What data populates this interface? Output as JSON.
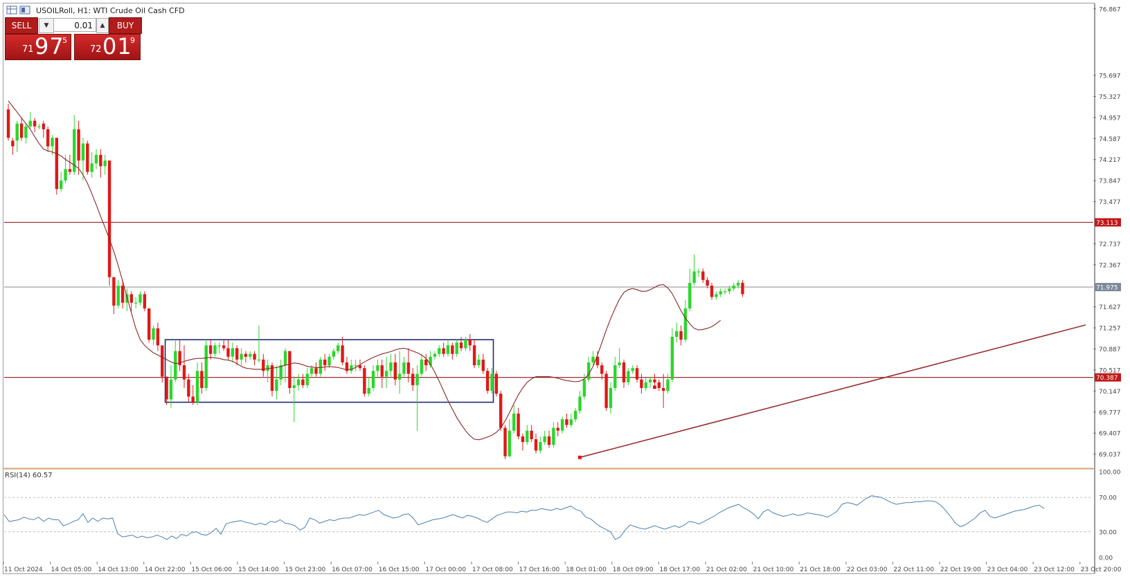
{
  "window": {
    "title": "USOILRoll, H1:  WTI Crude Oil Cash CFD"
  },
  "trade_panel": {
    "sell_label": "SELL",
    "buy_label": "BUY",
    "lot_value": "0.01",
    "sell_price": {
      "prefix": "71",
      "big": "97",
      "sup": "5"
    },
    "buy_price": {
      "prefix": "72",
      "big": "01",
      "sup": "9"
    }
  },
  "indicator": {
    "label": "RSI(14) 60.57"
  },
  "colors": {
    "bull": "#2bd62b",
    "bear": "#e01818",
    "ma_line": "#8b2525",
    "level_line": "#9a3030",
    "rsi_line": "#4a7fb0",
    "box": "#1e2a6e",
    "label_bg": "#c01818"
  },
  "chart_data": {
    "type": "candlestick",
    "symbol": "USOILRoll",
    "timeframe": "H1",
    "price_axis": {
      "ylim": [
        68.85,
        76.95
      ],
      "ticks": [
        "76.867",
        "75.697",
        "75.327",
        "74.957",
        "74.587",
        "74.217",
        "73.847",
        "73.477",
        "72.737",
        "72.367",
        "71.627",
        "71.257",
        "70.887",
        "70.517",
        "70.147",
        "69.777",
        "69.407",
        "69.037"
      ]
    },
    "time_axis": {
      "labels": [
        "11 Oct 2024",
        "14 Oct 05:00",
        "14 Oct 13:00",
        "14 Oct 22:00",
        "15 Oct 06:00",
        "15 Oct 14:00",
        "15 Oct 23:00",
        "16 Oct 07:00",
        "16 Oct 15:00",
        "17 Oct 00:00",
        "17 Oct 08:00",
        "17 Oct 16:00",
        "18 Oct 01:00",
        "18 Oct 09:00",
        "18 Oct 17:00",
        "21 Oct 02:00",
        "21 Oct 10:00",
        "21 Oct 18:00",
        "22 Oct 03:00",
        "22 Oct 11:00",
        "22 Oct 19:00",
        "23 Oct 04:00",
        "23 Oct 12:00",
        "23 Oct 20:00"
      ]
    },
    "horizontal_levels": [
      {
        "value": 73.113,
        "label": "73.113",
        "style": "red"
      },
      {
        "value": 71.975,
        "label": "71.975",
        "style": "grey"
      },
      {
        "value": 70.387,
        "label": "70.387",
        "style": "red"
      }
    ],
    "range_box": {
      "x_start": 36,
      "x_end": 110,
      "top": 71.05,
      "bottom": 69.95
    },
    "trendline": {
      "x1": 130,
      "y1": 68.98,
      "x2": 224,
      "y2": 71.31
    },
    "ma_values": [
      75.25,
      75.15,
      75.05,
      74.95,
      74.85,
      74.75,
      74.62,
      74.5,
      74.4,
      74.37,
      74.35,
      74.32,
      74.28,
      74.22,
      74.17,
      74.12,
      74.06,
      73.95,
      73.8,
      73.62,
      73.42,
      73.22,
      73.02,
      72.82,
      72.6,
      72.35,
      72.08,
      71.8,
      71.52,
      71.25,
      71.05,
      70.95,
      70.88,
      70.82,
      70.78,
      70.74,
      70.7,
      70.66,
      70.63,
      70.64,
      70.67,
      70.69,
      70.71,
      70.72,
      70.72,
      70.73,
      70.74,
      70.73,
      70.72,
      70.7,
      70.69,
      70.67,
      70.63,
      70.58,
      70.55,
      70.54,
      70.53,
      70.53,
      70.53,
      70.54,
      70.55,
      70.56,
      70.58,
      70.6,
      70.62,
      70.64,
      70.63,
      70.61,
      70.58,
      70.57,
      70.56,
      70.56,
      70.57,
      70.58,
      70.57,
      70.56,
      70.54,
      70.52,
      70.53,
      70.56,
      70.61,
      70.66,
      70.7,
      70.74,
      70.77,
      70.8,
      70.82,
      70.84,
      70.87,
      70.89,
      70.9,
      70.88,
      70.85,
      70.82,
      70.78,
      70.72,
      70.62,
      70.48,
      70.32,
      70.15,
      69.98,
      69.83,
      69.68,
      69.56,
      69.45,
      69.36,
      69.3,
      69.29,
      69.31,
      69.34,
      69.37,
      69.42,
      69.5,
      69.62,
      69.77,
      69.93,
      70.08,
      70.2,
      70.3,
      70.36,
      70.4,
      70.4,
      70.4,
      70.4,
      70.39,
      70.37,
      70.35,
      70.33,
      70.32,
      70.31,
      70.32,
      70.36,
      70.44,
      70.58,
      70.78,
      71.0,
      71.22,
      71.42,
      71.6,
      71.76,
      71.88,
      71.93,
      71.95,
      71.93,
      71.9,
      71.9,
      71.93,
      71.97,
      72.01,
      72.02,
      71.96,
      71.86,
      71.71,
      71.56,
      71.43,
      71.33,
      71.25,
      71.22,
      71.23,
      71.25,
      71.28,
      71.33,
      71.39
    ],
    "candles": [
      [
        75.1,
        74.6,
        75.2,
        74.55
      ],
      [
        74.55,
        74.45,
        74.6,
        74.3
      ],
      [
        74.55,
        74.85,
        74.9,
        74.35
      ],
      [
        74.85,
        74.6,
        74.95,
        74.55
      ],
      [
        74.6,
        74.8,
        74.85,
        74.5
      ],
      [
        74.8,
        74.9,
        75.05,
        74.75
      ],
      [
        74.9,
        74.8,
        74.95,
        74.7
      ],
      [
        74.8,
        74.8,
        74.85,
        74.75
      ],
      [
        74.85,
        74.75,
        74.9,
        74.6
      ],
      [
        74.75,
        74.45,
        74.8,
        74.35
      ],
      [
        74.45,
        74.6,
        74.65,
        74.3
      ],
      [
        74.6,
        73.7,
        74.6,
        73.6
      ],
      [
        73.7,
        73.85,
        74.0,
        73.65
      ],
      [
        73.85,
        74.05,
        74.3,
        73.8
      ],
      [
        74.05,
        74.0,
        74.3,
        73.95
      ],
      [
        74.0,
        74.75,
        75.0,
        73.95
      ],
      [
        74.75,
        74.2,
        74.9,
        73.95
      ],
      [
        74.2,
        74.5,
        74.6,
        73.85
      ],
      [
        74.5,
        74.0,
        74.55,
        73.95
      ],
      [
        74.0,
        74.15,
        74.35,
        73.9
      ],
      [
        74.15,
        74.3,
        74.4,
        74.05
      ],
      [
        74.3,
        74.1,
        74.4,
        73.9
      ],
      [
        74.1,
        74.2,
        74.3,
        73.95
      ],
      [
        74.2,
        72.15,
        74.2,
        72.0
      ],
      [
        72.15,
        71.65,
        72.15,
        71.5
      ],
      [
        71.65,
        72.0,
        72.1,
        71.6
      ],
      [
        72.0,
        71.7,
        72.1,
        71.6
      ],
      [
        71.7,
        71.85,
        71.95,
        71.55
      ],
      [
        71.85,
        71.7,
        71.9,
        71.55
      ],
      [
        71.7,
        71.7,
        71.8,
        71.6
      ],
      [
        71.7,
        71.85,
        71.9,
        71.65
      ],
      [
        71.85,
        71.6,
        71.9,
        71.55
      ],
      [
        71.6,
        71.05,
        71.6,
        71.0
      ],
      [
        71.05,
        71.25,
        71.3,
        70.95
      ],
      [
        71.25,
        70.95,
        71.35,
        70.85
      ],
      [
        70.95,
        70.4,
        70.95,
        70.3
      ],
      [
        70.4,
        70.0,
        70.4,
        69.9
      ],
      [
        70.0,
        70.35,
        70.6,
        69.85
      ],
      [
        70.35,
        70.85,
        71.05,
        70.3
      ],
      [
        70.85,
        70.6,
        71.05,
        70.5
      ],
      [
        70.6,
        70.35,
        70.95,
        70.2
      ],
      [
        70.35,
        70.05,
        70.45,
        69.95
      ],
      [
        70.05,
        69.95,
        70.25,
        69.9
      ],
      [
        69.95,
        70.5,
        70.65,
        69.9
      ],
      [
        70.5,
        70.2,
        70.65,
        70.1
      ],
      [
        70.2,
        70.95,
        71.05,
        70.15
      ],
      [
        70.95,
        70.8,
        71.05,
        70.7
      ],
      [
        70.8,
        70.95,
        71.0,
        70.75
      ],
      [
        70.95,
        70.95,
        71.0,
        70.8
      ],
      [
        70.95,
        70.9,
        71.05,
        70.85
      ],
      [
        70.9,
        70.75,
        71.05,
        70.7
      ],
      [
        70.75,
        70.9,
        71.0,
        70.65
      ],
      [
        70.9,
        70.7,
        70.95,
        70.6
      ],
      [
        70.7,
        70.8,
        70.9,
        70.6
      ],
      [
        70.8,
        70.75,
        70.85,
        70.65
      ],
      [
        70.75,
        70.8,
        70.85,
        70.7
      ],
      [
        70.8,
        70.7,
        70.85,
        70.6
      ],
      [
        70.7,
        70.7,
        71.3,
        70.65
      ],
      [
        70.7,
        70.5,
        70.8,
        70.4
      ],
      [
        70.5,
        70.6,
        70.7,
        70.3
      ],
      [
        70.6,
        70.15,
        70.65,
        70.05
      ],
      [
        70.15,
        70.35,
        70.6,
        70.0
      ],
      [
        70.35,
        70.6,
        70.7,
        70.25
      ],
      [
        70.6,
        70.85,
        70.9,
        70.3
      ],
      [
        70.85,
        70.2,
        70.85,
        70.1
      ],
      [
        70.2,
        70.25,
        70.4,
        69.6
      ],
      [
        70.25,
        70.35,
        70.45,
        70.15
      ],
      [
        70.35,
        70.25,
        70.45,
        70.2
      ],
      [
        70.25,
        70.45,
        70.55,
        70.2
      ],
      [
        70.45,
        70.55,
        70.6,
        70.4
      ],
      [
        70.55,
        70.45,
        70.65,
        70.4
      ],
      [
        70.45,
        70.7,
        70.75,
        70.4
      ],
      [
        70.7,
        70.6,
        70.8,
        70.5
      ],
      [
        70.6,
        70.75,
        70.8,
        70.55
      ],
      [
        70.75,
        70.85,
        70.9,
        70.7
      ],
      [
        70.85,
        70.95,
        71.0,
        70.8
      ],
      [
        70.95,
        70.65,
        71.1,
        70.6
      ],
      [
        70.65,
        70.5,
        70.75,
        70.45
      ],
      [
        70.5,
        70.6,
        70.7,
        70.45
      ],
      [
        70.6,
        70.6,
        70.7,
        70.5
      ],
      [
        70.6,
        70.55,
        70.7,
        70.5
      ],
      [
        70.55,
        70.1,
        70.6,
        70.05
      ],
      [
        70.1,
        70.2,
        70.4,
        70.05
      ],
      [
        70.2,
        70.5,
        70.6,
        70.15
      ],
      [
        70.5,
        70.6,
        70.7,
        70.4
      ],
      [
        70.6,
        70.4,
        70.7,
        70.2
      ],
      [
        70.4,
        70.5,
        70.75,
        70.2
      ],
      [
        70.5,
        70.65,
        70.8,
        70.4
      ],
      [
        70.65,
        70.35,
        70.8,
        70.25
      ],
      [
        70.35,
        70.45,
        70.85,
        70.1
      ],
      [
        70.45,
        70.65,
        70.75,
        70.4
      ],
      [
        70.65,
        70.45,
        70.9,
        70.3
      ],
      [
        70.45,
        70.25,
        70.55,
        70.15
      ],
      [
        70.25,
        70.45,
        70.6,
        69.45
      ],
      [
        70.45,
        70.7,
        70.8,
        70.4
      ],
      [
        70.7,
        70.6,
        70.8,
        70.5
      ],
      [
        70.6,
        70.75,
        70.85,
        70.55
      ],
      [
        70.75,
        70.8,
        70.85,
        70.7
      ],
      [
        70.8,
        70.9,
        70.95,
        70.75
      ],
      [
        70.9,
        70.8,
        71.0,
        70.75
      ],
      [
        70.8,
        70.95,
        71.05,
        70.75
      ],
      [
        70.95,
        70.8,
        71.0,
        70.7
      ],
      [
        70.8,
        71.0,
        71.05,
        70.75
      ],
      [
        71.0,
        70.9,
        71.1,
        70.85
      ],
      [
        70.9,
        71.05,
        71.1,
        70.85
      ],
      [
        71.05,
        70.95,
        71.15,
        70.85
      ],
      [
        70.95,
        70.6,
        71.05,
        70.55
      ],
      [
        70.6,
        70.7,
        70.8,
        70.55
      ],
      [
        70.7,
        70.5,
        70.8,
        70.45
      ],
      [
        70.5,
        70.15,
        70.55,
        70.1
      ],
      [
        70.15,
        70.45,
        70.55,
        70.1
      ],
      [
        70.45,
        70.1,
        70.5,
        70.05
      ],
      [
        70.1,
        69.5,
        70.15,
        69.45
      ],
      [
        69.5,
        69.0,
        69.55,
        68.95
      ],
      [
        69.0,
        69.45,
        69.65,
        68.98
      ],
      [
        69.45,
        69.75,
        69.9,
        69.4
      ],
      [
        69.75,
        69.35,
        69.85,
        69.3
      ],
      [
        69.35,
        69.25,
        69.4,
        69.1
      ],
      [
        69.25,
        69.45,
        69.55,
        69.2
      ],
      [
        69.45,
        69.3,
        69.55,
        69.25
      ],
      [
        69.3,
        69.1,
        69.4,
        69.05
      ],
      [
        69.1,
        69.25,
        69.35,
        69.05
      ],
      [
        69.25,
        69.35,
        69.45,
        69.2
      ],
      [
        69.35,
        69.2,
        69.45,
        69.15
      ],
      [
        69.2,
        69.5,
        69.6,
        69.15
      ],
      [
        69.5,
        69.45,
        69.6,
        69.35
      ],
      [
        69.45,
        69.65,
        69.7,
        69.4
      ],
      [
        69.65,
        69.55,
        69.75,
        69.5
      ],
      [
        69.55,
        69.65,
        69.75,
        69.5
      ],
      [
        69.65,
        69.8,
        69.85,
        69.6
      ],
      [
        69.8,
        70.05,
        70.15,
        69.75
      ],
      [
        70.05,
        70.35,
        70.45,
        70.0
      ],
      [
        70.35,
        70.65,
        70.75,
        70.3
      ],
      [
        70.65,
        70.75,
        70.85,
        70.6
      ],
      [
        70.75,
        70.6,
        70.85,
        70.55
      ],
      [
        70.6,
        70.45,
        70.65,
        70.35
      ],
      [
        70.45,
        69.85,
        70.5,
        69.8
      ],
      [
        69.85,
        70.2,
        70.3,
        69.75
      ],
      [
        70.2,
        70.6,
        70.75,
        70.15
      ],
      [
        70.6,
        70.65,
        70.9,
        70.55
      ],
      [
        70.65,
        70.3,
        70.7,
        70.2
      ],
      [
        70.3,
        70.5,
        70.55,
        70.25
      ],
      [
        70.5,
        70.55,
        70.6,
        70.45
      ],
      [
        70.55,
        70.35,
        70.6,
        70.3
      ],
      [
        70.35,
        70.2,
        70.45,
        70.1
      ],
      [
        70.2,
        70.3,
        70.4,
        70.15
      ],
      [
        70.3,
        70.35,
        70.4,
        70.2
      ],
      [
        70.35,
        70.3,
        70.45,
        70.25
      ],
      [
        70.3,
        70.2,
        70.35,
        70.15
      ],
      [
        70.2,
        70.15,
        70.45,
        69.85
      ],
      [
        70.15,
        70.35,
        70.45,
        70.1
      ],
      [
        70.35,
        71.1,
        71.25,
        70.3
      ],
      [
        71.1,
        71.2,
        71.35,
        71.0
      ],
      [
        71.2,
        71.05,
        71.3,
        70.95
      ],
      [
        71.05,
        71.6,
        71.75,
        71.0
      ],
      [
        71.6,
        72.05,
        72.3,
        71.55
      ],
      [
        72.05,
        72.25,
        72.55,
        72.0
      ],
      [
        72.25,
        72.25,
        72.3,
        72.15
      ],
      [
        72.25,
        72.1,
        72.3,
        72.05
      ],
      [
        72.1,
        72.0,
        72.15,
        71.95
      ],
      [
        72.0,
        71.8,
        72.05,
        71.75
      ],
      [
        71.8,
        71.85,
        71.9,
        71.75
      ],
      [
        71.85,
        71.9,
        71.95,
        71.8
      ],
      [
        71.9,
        71.9,
        71.95,
        71.85
      ],
      [
        71.9,
        71.95,
        72.0,
        71.85
      ],
      [
        71.95,
        72.0,
        72.05,
        71.9
      ],
      [
        72.0,
        72.05,
        72.1,
        71.95
      ],
      [
        72.05,
        71.85,
        72.1,
        71.8
      ]
    ],
    "rsi": {
      "ylim": [
        0,
        100
      ],
      "ticks": [
        "100.00",
        "70.00",
        "30.00",
        "0.00"
      ],
      "levels": [
        70,
        30
      ],
      "values": [
        50,
        42,
        43,
        44,
        47,
        45,
        44,
        47,
        42,
        46,
        44,
        44,
        37,
        39,
        42,
        44,
        51,
        41,
        46,
        42,
        46,
        45,
        46,
        28,
        24,
        25,
        26,
        23,
        25,
        23,
        24,
        26,
        24,
        21,
        25,
        22,
        27,
        25,
        29,
        30,
        27,
        26,
        29,
        34,
        27,
        39,
        41,
        42,
        43,
        41,
        40,
        38,
        40,
        38,
        42,
        41,
        44,
        40,
        39,
        37,
        32,
        35,
        46,
        44,
        40,
        42,
        44,
        43,
        45,
        46,
        46,
        48,
        50,
        49,
        51,
        53,
        55,
        50,
        48,
        46,
        47,
        50,
        51,
        46,
        38,
        40,
        42,
        44,
        45,
        46,
        48,
        50,
        48,
        46,
        49,
        48,
        46,
        43,
        41,
        45,
        49,
        51,
        53,
        53,
        52,
        54,
        53,
        55,
        55,
        57,
        56,
        55,
        57,
        56,
        58,
        60,
        56,
        54,
        47,
        45,
        40,
        36,
        33,
        30,
        21,
        24,
        32,
        38,
        36,
        34,
        33,
        35,
        37,
        35,
        33,
        35,
        37,
        35,
        38,
        42,
        41,
        39,
        42,
        45,
        48,
        52,
        55,
        58,
        60,
        62,
        58,
        55,
        51,
        45,
        53,
        56,
        52,
        50,
        48,
        49,
        51,
        49,
        50,
        52,
        51,
        50,
        49,
        47,
        50,
        54,
        62,
        64,
        63,
        61,
        65,
        69,
        72,
        71,
        70,
        67,
        64,
        62,
        63,
        64,
        64,
        65,
        65,
        66,
        66,
        65,
        61,
        55,
        48,
        40,
        36,
        38,
        42,
        46,
        52,
        55,
        48,
        46,
        48,
        50,
        52,
        54,
        55,
        56,
        58,
        60,
        61,
        57
      ]
    }
  }
}
